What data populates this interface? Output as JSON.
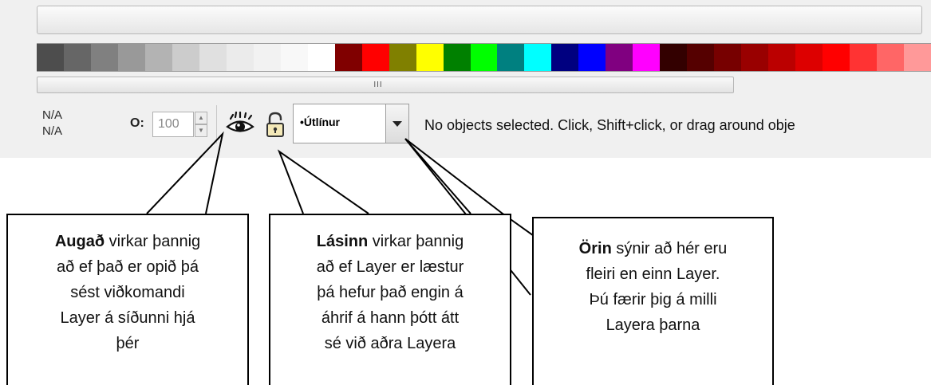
{
  "palette": {
    "colors": [
      "#4d4d4d",
      "#666666",
      "#808080",
      "#999999",
      "#b3b3b3",
      "#cccccc",
      "#e0e0e0",
      "#ebebeb",
      "#f2f2f2",
      "#f8f8f8",
      "#ffffff",
      "#800000",
      "#ff0000",
      "#808000",
      "#ffff00",
      "#008000",
      "#00ff00",
      "#008080",
      "#00ffff",
      "#000080",
      "#0000ff",
      "#800080",
      "#ff00ff",
      "#330000",
      "#550000",
      "#770000",
      "#990000",
      "#bb0000",
      "#dd0000",
      "#ff0000",
      "#ff3333",
      "#ff6666",
      "#ff9999"
    ]
  },
  "scrollbar": {
    "grip": "III"
  },
  "status_bar": {
    "coord_x": "N/A",
    "coord_y": "N/A",
    "opacity_label": "O:",
    "opacity_value": "100",
    "layer_name": "•Útlínur",
    "message": "No objects selected. Click, Shift+click, or drag around obje"
  },
  "callouts": {
    "eye": {
      "bold": "Augað",
      "lines": [
        " virkar þannig",
        "að ef það er opið þá",
        "sést viðkomandi",
        "Layer á síðunni  hjá",
        "þér"
      ]
    },
    "lock": {
      "bold": "Lásinn",
      "lines": [
        " virkar þannig",
        "að ef Layer er læstur",
        "þá hefur það engin á",
        "áhrif á hann þótt átt",
        "sé við aðra Layera"
      ]
    },
    "arrow": {
      "bold": "Örin",
      "lines": [
        " sýnir að hér eru",
        "fleiri en einn Layer.",
        "Þú færir þig á milli",
        "Layera þarna"
      ]
    }
  },
  "icons": {
    "eye": "eye-icon",
    "lock": "padlock-icon",
    "dropdown": "chevron-down-icon"
  }
}
